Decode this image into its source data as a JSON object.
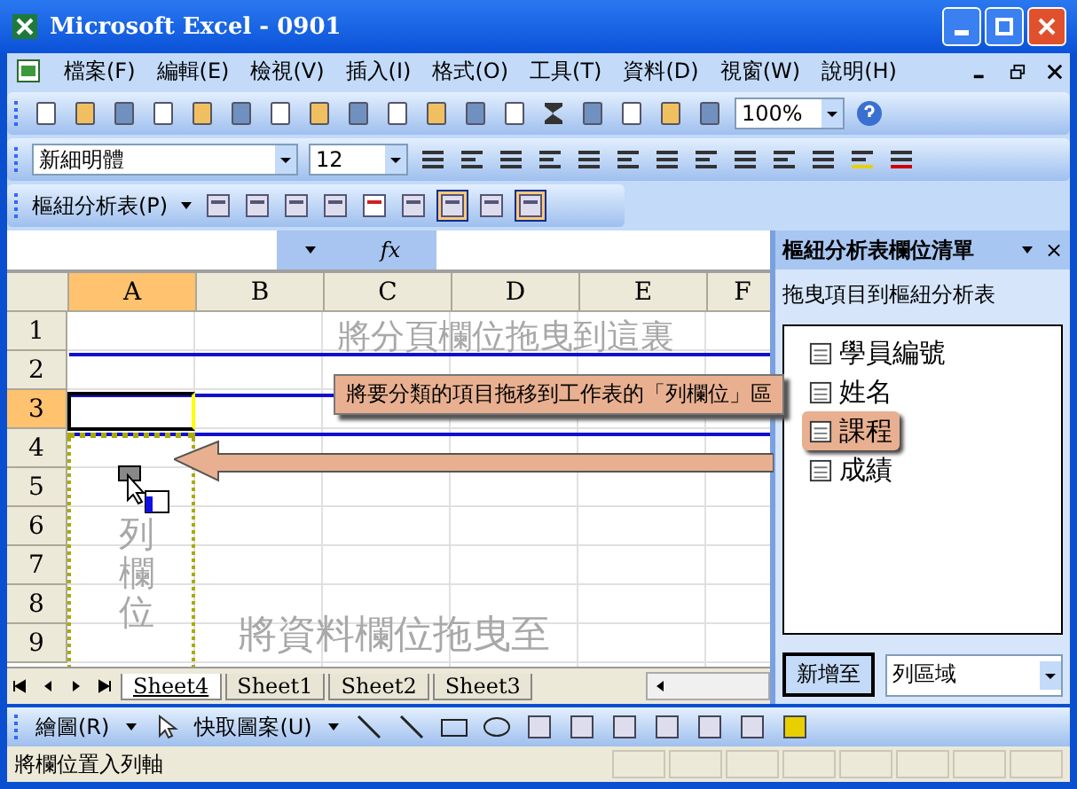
{
  "window": {
    "title": "Microsoft Excel - 0901"
  },
  "menu": [
    "檔案(F)",
    "編輯(E)",
    "檢視(V)",
    "插入(I)",
    "格式(O)",
    "工具(T)",
    "資料(D)",
    "視窗(W)",
    "說明(H)"
  ],
  "standard_toolbar": {
    "zoom": "100%"
  },
  "formatting_toolbar": {
    "font": "新細明體",
    "size": "12"
  },
  "pivot_toolbar": {
    "menu": "樞紐分析表(P)"
  },
  "formula_bar": {
    "fx": "fx"
  },
  "sheet": {
    "columns": [
      {
        "label": "A",
        "selected": true
      },
      {
        "label": "B",
        "selected": false
      },
      {
        "label": "C",
        "selected": false
      },
      {
        "label": "D",
        "selected": false
      },
      {
        "label": "E",
        "selected": false
      },
      {
        "label": "F",
        "selected": false
      }
    ],
    "rows": [
      {
        "label": "1",
        "selected": false
      },
      {
        "label": "2",
        "selected": false
      },
      {
        "label": "3",
        "selected": true
      },
      {
        "label": "4",
        "selected": false
      },
      {
        "label": "5",
        "selected": false
      },
      {
        "label": "6",
        "selected": false
      },
      {
        "label": "7",
        "selected": false
      },
      {
        "label": "8",
        "selected": false
      },
      {
        "label": "9",
        "selected": false
      }
    ],
    "page_area_hint": "將分頁欄位拖曳到這裏",
    "row_area_hint": "列欄位",
    "data_area_hint": "將資料欄位拖曳至"
  },
  "callout": "將要分類的項目拖移到工作表的「列欄位」區",
  "sheet_tabs": [
    {
      "label": "Sheet4",
      "selected": true
    },
    {
      "label": "Sheet1",
      "selected": false
    },
    {
      "label": "Sheet2",
      "selected": false
    },
    {
      "label": "Sheet3",
      "selected": false
    }
  ],
  "field_list": {
    "title": "樞紐分析表欄位清單",
    "close": "×",
    "subtitle": "拖曳項目到樞紐分析表",
    "fields": [
      {
        "label": "學員編號",
        "selected": false
      },
      {
        "label": "姓名",
        "selected": false
      },
      {
        "label": "課程",
        "selected": true
      },
      {
        "label": "成績",
        "selected": false
      }
    ],
    "add_button": "新增至",
    "area": "列區域"
  },
  "drawing_toolbar": {
    "draw_menu": "繪圖(R)",
    "autoshapes_menu": "快取圖案(U)"
  },
  "status_bar": "將欄位置入列軸"
}
